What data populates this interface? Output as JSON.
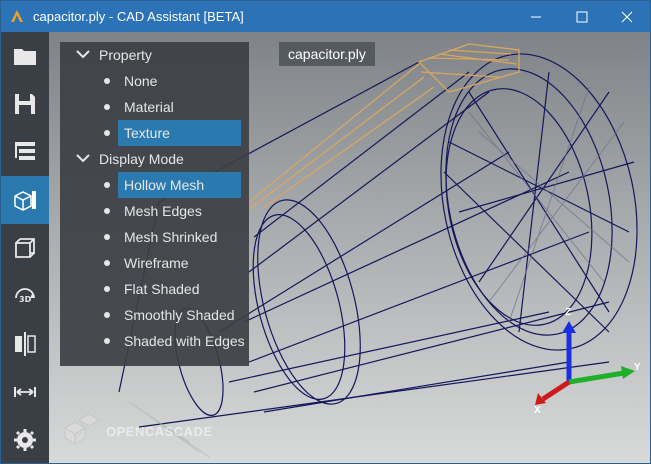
{
  "window": {
    "title": "capacitor.ply - CAD Assistant [BETA]",
    "minimize": "—",
    "maximize": "☐",
    "close": "✕"
  },
  "toolbar": {
    "items": [
      {
        "icon": "folder-icon"
      },
      {
        "icon": "save-icon"
      },
      {
        "icon": "model-tree-icon"
      },
      {
        "icon": "display-mode-icon",
        "active": true
      },
      {
        "icon": "wireframe-cube-icon"
      },
      {
        "icon": "view-3d-icon"
      },
      {
        "icon": "clipping-icon"
      },
      {
        "icon": "measure-icon"
      },
      {
        "icon": "settings-icon"
      }
    ]
  },
  "viewport": {
    "filename": "capacitor.ply",
    "watermark": "OPENCASCADE",
    "axes": {
      "x": "X",
      "y": "Y",
      "z": "Z"
    }
  },
  "panel": {
    "property": {
      "label": "Property",
      "options": [
        "None",
        "Material",
        "Texture"
      ],
      "selected": "Texture"
    },
    "display_mode": {
      "label": "Display Mode",
      "options": [
        "Hollow Mesh",
        "Mesh Edges",
        "Mesh Shrinked",
        "Wireframe",
        "Flat Shaded",
        "Smoothly Shaded",
        "Shaded with Edges"
      ],
      "selected": "Hollow Mesh"
    }
  },
  "colors": {
    "titlebar": "#2c72b6",
    "accent": "#2a7ab0",
    "mesh": "#14185a",
    "mesh_top": "#d9a660"
  }
}
